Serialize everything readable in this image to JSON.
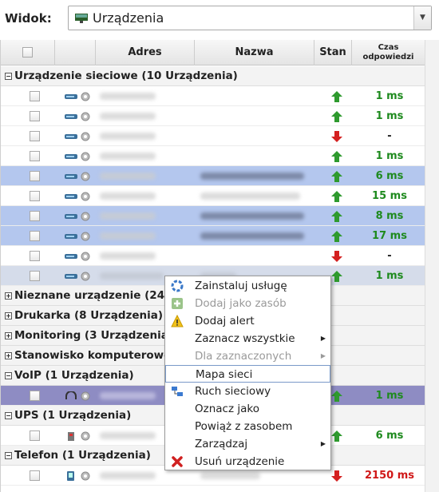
{
  "toolbar": {
    "view_label": "Widok:",
    "view_value": "Urządzenia"
  },
  "columns": {
    "address": "Adres",
    "name": "Nazwa",
    "state": "Stan",
    "response_l1": "Czas",
    "response_l2": "odpowiedzi"
  },
  "groups": {
    "network": "Urządzenie sieciowe (10 Urządzenia)",
    "unknown": "Nieznane urządzenie (247",
    "printer": "Drukarka (8 Urządzenia)",
    "monitoring": "Monitoring (3 Urządzenia)",
    "workstation": "Stanowisko komputerowe",
    "voip": "VoIP (1 Urządzenia)",
    "ups": "UPS (1 Urządzenia)",
    "phone": "Telefon (1 Urządzenia)"
  },
  "rows": [
    {
      "state": "up",
      "time": "1 ms"
    },
    {
      "state": "up",
      "time": "1 ms"
    },
    {
      "state": "down",
      "time": "-"
    },
    {
      "state": "up",
      "time": "1 ms"
    },
    {
      "state": "up",
      "time": "6 ms"
    },
    {
      "state": "up",
      "time": "15 ms"
    },
    {
      "state": "up",
      "time": "8 ms"
    },
    {
      "state": "up",
      "time": "17 ms"
    },
    {
      "state": "down",
      "time": "-"
    },
    {
      "state": "up",
      "time": "1 ms"
    },
    {
      "state": "up",
      "time": "1 ms"
    },
    {
      "state": "up",
      "time": "6 ms"
    },
    {
      "state": "down",
      "time": "2150 ms"
    }
  ],
  "menu": {
    "install": "Zainstaluj usługę",
    "add_asset": "Dodaj jako zasób",
    "add_alert": "Dodaj alert",
    "select_all": "Zaznacz wszystkie",
    "for_selected": "Dla zaznaczonych",
    "network_map": "Mapa sieci",
    "traffic": "Ruch sieciowy",
    "mark_as": "Oznacz jako",
    "link_asset": "Powiąż z zasobem",
    "manage": "Zarządzaj",
    "remove": "Usuń urządzenie"
  },
  "colors": {
    "up": "#2e9a2e",
    "down": "#d42020",
    "selected": "#b4c7ee",
    "voip": "#8e8cc3"
  }
}
